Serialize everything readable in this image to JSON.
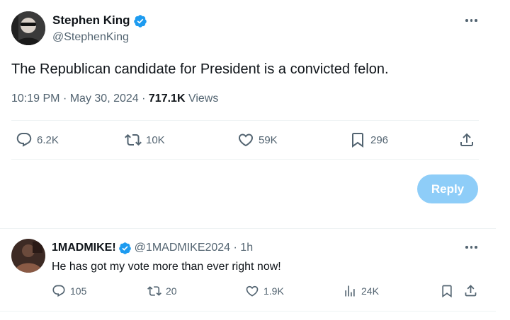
{
  "tweet": {
    "author_name": "Stephen King",
    "handle": "@StephenKing",
    "text": "The Republican candidate for President is a convicted felon.",
    "time": "10:19 PM",
    "date": "May 30, 2024",
    "views_count": "717.1K",
    "views_label": "Views",
    "stats": {
      "replies": "6.2K",
      "reposts": "10K",
      "likes": "59K",
      "bookmarks": "296"
    }
  },
  "composer": {
    "reply_button_label": "Reply"
  },
  "reply": {
    "author_name": "1MADMIKE!",
    "handle": "@1MADMIKE2024",
    "time_ago": "1h",
    "text": "He has got my vote more than ever right now!",
    "stats": {
      "replies": "105",
      "reposts": "20",
      "likes": "1.9K",
      "views": "24K"
    }
  },
  "colors": {
    "accent": "#1d9bf0",
    "reply_button_disabled": "#8ecdf8",
    "text": "#0f1419",
    "muted": "#536471",
    "divider": "#eff3f4"
  }
}
